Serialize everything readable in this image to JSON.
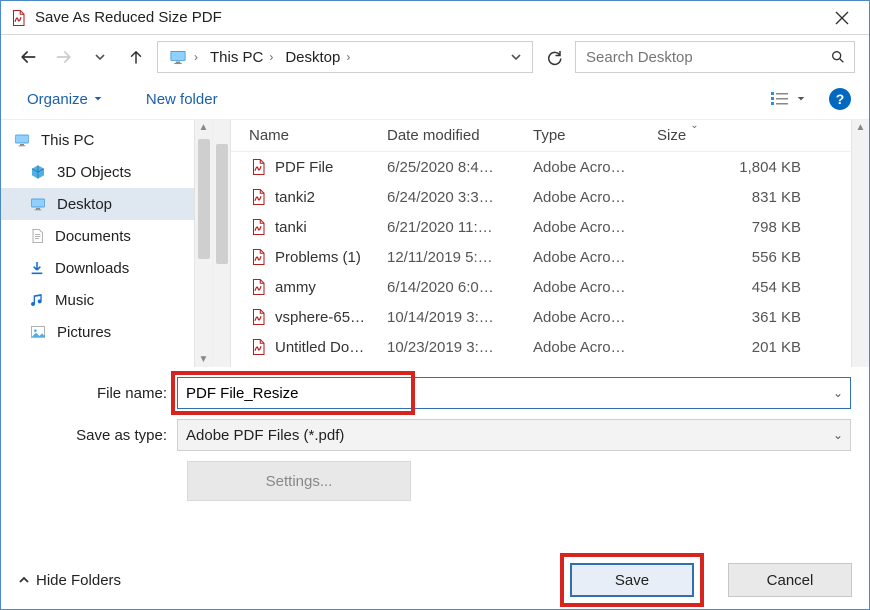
{
  "window": {
    "title": "Save As Reduced Size PDF"
  },
  "nav": {
    "path": {
      "seg1": "This PC",
      "seg2": "Desktop"
    },
    "search_placeholder": "Search Desktop"
  },
  "toolbar": {
    "organize_label": "Organize",
    "new_folder_label": "New folder"
  },
  "sidebar": {
    "items": [
      {
        "label": "This PC"
      },
      {
        "label": "3D Objects"
      },
      {
        "label": "Desktop"
      },
      {
        "label": "Documents"
      },
      {
        "label": "Downloads"
      },
      {
        "label": "Music"
      },
      {
        "label": "Pictures"
      }
    ],
    "selected_index": 2
  },
  "columns": {
    "name": "Name",
    "date": "Date modified",
    "type": "Type",
    "size": "Size"
  },
  "files": [
    {
      "name": "PDF File",
      "date": "6/25/2020 8:4…",
      "type": "Adobe Acro…",
      "size": "1,804 KB"
    },
    {
      "name": "tanki2",
      "date": "6/24/2020 3:3…",
      "type": "Adobe Acro…",
      "size": "831 KB"
    },
    {
      "name": "tanki",
      "date": "6/21/2020 11:…",
      "type": "Adobe Acro…",
      "size": "798 KB"
    },
    {
      "name": "Problems (1)",
      "date": "12/11/2019 5:…",
      "type": "Adobe Acro…",
      "size": "556 KB"
    },
    {
      "name": "ammy",
      "date": "6/14/2020 6:0…",
      "type": "Adobe Acro…",
      "size": "454 KB"
    },
    {
      "name": "vsphere-65…",
      "date": "10/14/2019 3:…",
      "type": "Adobe Acro…",
      "size": "361 KB"
    },
    {
      "name": "Untitled Do…",
      "date": "10/23/2019 3:…",
      "type": "Adobe Acro…",
      "size": "201 KB"
    }
  ],
  "form": {
    "filename_label": "File name:",
    "filename_value": "PDF File_Resize",
    "type_label": "Save as type:",
    "type_value": "Adobe PDF Files (*.pdf)",
    "settings_label": "Settings..."
  },
  "footer": {
    "hide_folders_label": "Hide Folders",
    "save_label": "Save",
    "cancel_label": "Cancel"
  }
}
